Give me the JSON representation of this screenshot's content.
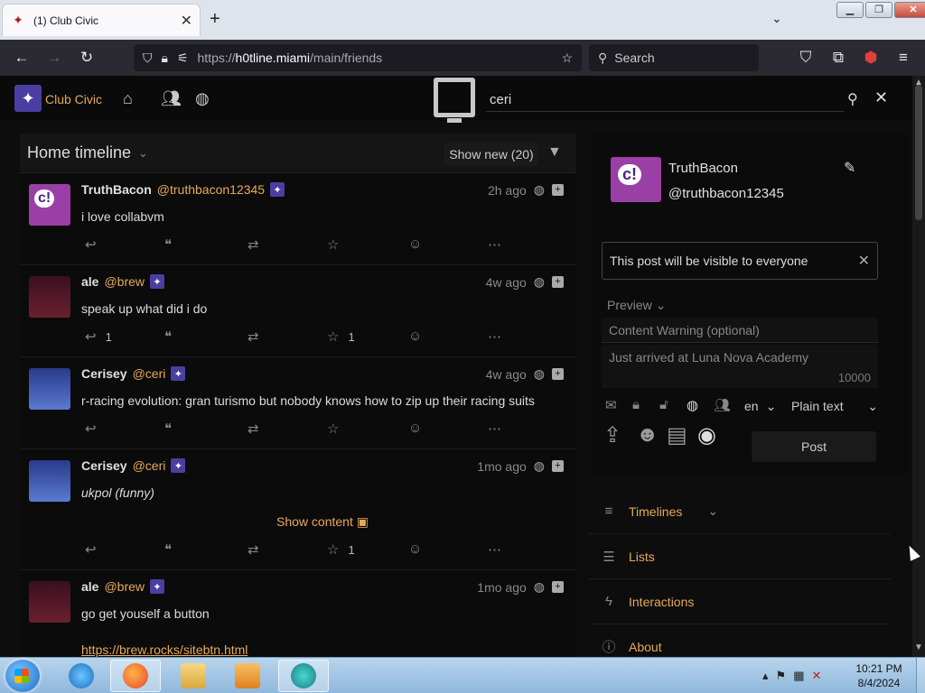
{
  "browser": {
    "tab_title": "(1) Club Civic",
    "url_scheme": "https://",
    "url_host": "h0tline.miami",
    "url_path": "/main/friends",
    "search_placeholder": "Search"
  },
  "site": {
    "name": "Club Civic",
    "search_value": "ceri"
  },
  "timeline": {
    "title": "Home timeline",
    "show_new": "Show new (20)",
    "posts": [
      {
        "name": "TruthBacon",
        "handle": "@truthbacon12345",
        "time": "2h ago",
        "body": "i love collabvm",
        "reply_count": "",
        "fav_count": ""
      },
      {
        "name": "ale",
        "handle": "@brew",
        "time": "4w ago",
        "body": "speak up what did i do",
        "reply_count": "1",
        "fav_count": "1"
      },
      {
        "name": "Cerisey",
        "handle": "@ceri",
        "time": "4w ago",
        "body": "r-racing evolution: gran turismo but nobody knows how to zip up their racing suits",
        "reply_count": "",
        "fav_count": ""
      },
      {
        "name": "Cerisey",
        "handle": "@ceri",
        "time": "1mo ago",
        "body": "ukpol (funny)",
        "show_content": "Show content",
        "reply_count": "",
        "fav_count": "1"
      },
      {
        "name": "ale",
        "handle": "@brew",
        "time": "1mo ago",
        "body": "go get youself a button",
        "link": "https://brew.rocks/sitebtn.html"
      }
    ]
  },
  "compose": {
    "name": "TruthBacon",
    "handle": "@truthbacon12345",
    "visibility_note": "This post will be visible to everyone",
    "preview": "Preview",
    "cw_placeholder": "Content Warning (optional)",
    "body_placeholder": "Just arrived at Luna Nova Academy",
    "counter": "10000",
    "language": "en",
    "format": "Plain text",
    "post_button": "Post"
  },
  "side_menu": [
    {
      "label": "Timelines"
    },
    {
      "label": "Lists"
    },
    {
      "label": "Interactions"
    },
    {
      "label": "About"
    }
  ],
  "taskbar": {
    "time": "10:21 PM",
    "date": "8/4/2024"
  },
  "colors": {
    "accent": "#e8a95a",
    "page_bg": "#0d0d0d",
    "panel_bg": "#0b0b0b"
  }
}
